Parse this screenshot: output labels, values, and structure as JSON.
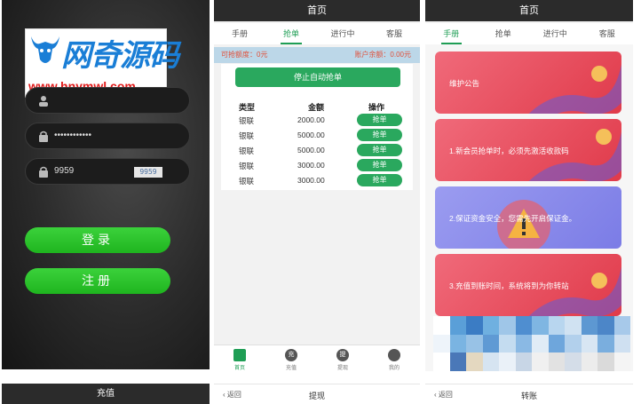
{
  "login": {
    "watermark_title": "网奇源码",
    "watermark_url": "www.hnymwl.com",
    "password_value": "••••••••••••",
    "captcha_input": "9959",
    "captcha_image": "9959",
    "login_label": "登录",
    "register_label": "注册"
  },
  "grab": {
    "header": "首页",
    "tabs": [
      "手册",
      "抢单",
      "进行中",
      "客服"
    ],
    "active_tab": "抢单",
    "limit_label": "可抢额度：0元",
    "balance_label": "账户余额：0.00元",
    "auto_button": "停止自动抢单",
    "columns": [
      "类型",
      "金额",
      "操作"
    ],
    "rows": [
      {
        "type": "银联",
        "amount": "2000.00",
        "action": "抢单"
      },
      {
        "type": "银联",
        "amount": "5000.00",
        "action": "抢单"
      },
      {
        "type": "银联",
        "amount": "5000.00",
        "action": "抢单"
      },
      {
        "type": "银联",
        "amount": "3000.00",
        "action": "抢单"
      },
      {
        "type": "银联",
        "amount": "3000.00",
        "action": "抢单"
      }
    ],
    "nav": [
      {
        "label": "首页",
        "icon": "home-icon",
        "glyph": ""
      },
      {
        "label": "充值",
        "icon": "recharge-icon",
        "glyph": "充"
      },
      {
        "label": "提现",
        "icon": "withdraw-icon",
        "glyph": "提"
      },
      {
        "label": "我的",
        "icon": "user-icon",
        "glyph": ""
      }
    ]
  },
  "manual": {
    "header": "首页",
    "tabs": [
      "手册",
      "抢单",
      "进行中",
      "客服"
    ],
    "active_tab": "手册",
    "notices": [
      "维护公告",
      "1.新会员抢单时，必须先激活收款码",
      "2.保证资金安全，您需先开启保证金。",
      "3.充值到账时间，系统将到为你转站"
    ]
  },
  "bottom": {
    "recharge_title": "充值",
    "withdraw_back": "返回",
    "withdraw_title": "提现",
    "transfer_back": "返回",
    "transfer_title": "转账"
  },
  "colors": {
    "accent_green": "#1f9e55",
    "login_green": "#2bc62b",
    "notice_red": "#e8505f",
    "notice_purple": "#8a8bec"
  }
}
